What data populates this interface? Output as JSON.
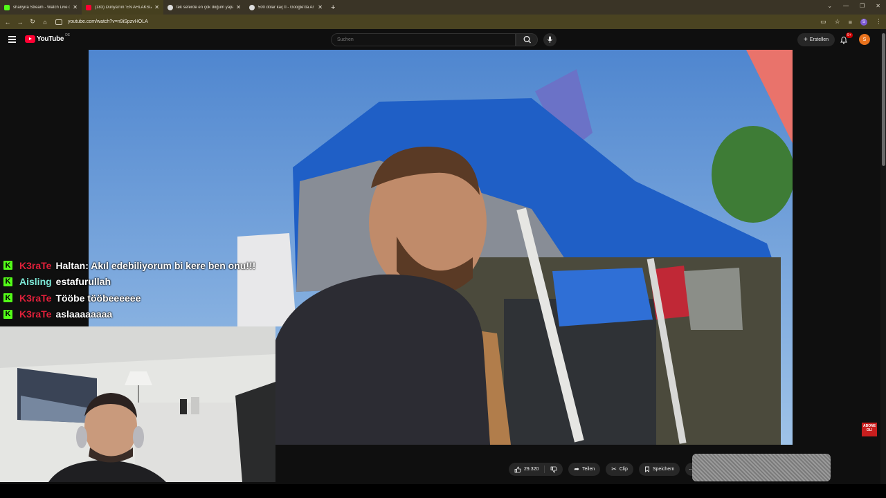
{
  "browser": {
    "tabs": [
      {
        "title": "shanyira Stream - Watch Live o",
        "favicon_color": "#53fc18"
      },
      {
        "title": "(183) Dünya'nın 'EN AHLAKSIZ",
        "favicon_color": "#ff0033"
      },
      {
        "title": "tek seferde en çok doğum yapa",
        "favicon_color": "#dddddd"
      },
      {
        "title": "500 dolar kaç tl - Google'da Ar",
        "favicon_color": "#dddddd"
      }
    ],
    "new_tab": "+",
    "url": "youtube.com/watch?v=n9iSpzvHOLA",
    "profile_initial": "S"
  },
  "youtube": {
    "logo_text": "YouTube",
    "country_code": "DE",
    "search_placeholder": "Suchen",
    "create_label": "Erstellen",
    "notif_count": "9+",
    "avatar_initial": "S"
  },
  "chat": [
    {
      "user": "K3raTe",
      "user_color": "#e0203a",
      "message": "Haltan: Akıl edebiliyorum bi kere ben onu!!!"
    },
    {
      "user": "Aisling",
      "user_color": "#7de8d7",
      "message": "estafurullah"
    },
    {
      "user": "K3raTe",
      "user_color": "#e0203a",
      "message": "Tööbe tööbeeeeee"
    },
    {
      "user": "K3raTe",
      "user_color": "#e0203a",
      "message": "aslaaaaaaaa"
    }
  ],
  "actions": {
    "like_count": "29.320",
    "share_label": "Teilen",
    "clip_label": "Clip",
    "save_label": "Speichern"
  },
  "overlay": {
    "abone_line1": "ABONE",
    "abone_line2": "OL!"
  }
}
